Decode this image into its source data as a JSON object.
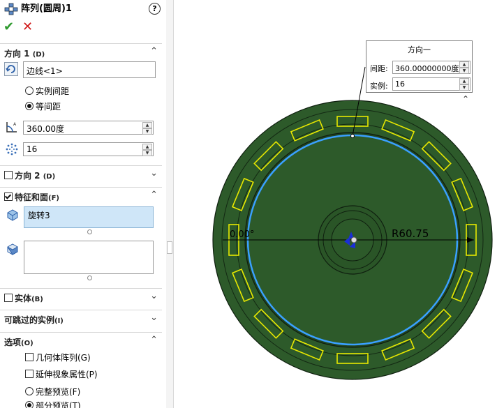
{
  "header": {
    "title": "阵列(圆周)1",
    "help": "?",
    "ok": "✔",
    "cancel": "✕"
  },
  "direction1": {
    "label": "方向 1",
    "key": "(D)",
    "edge": "边线<1>",
    "radio_instance": "实例间距",
    "radio_equal": "等间距",
    "angle": "360.00度",
    "count": "16"
  },
  "direction2": {
    "label": "方向 2",
    "key": "(D)"
  },
  "features": {
    "label": "特征和面",
    "key": "(F)",
    "item": "旋转3"
  },
  "bodies": {
    "label": "实体",
    "key": "(B)"
  },
  "skip": {
    "label": "可跳过的实例",
    "key": "(I)"
  },
  "options": {
    "label": "选项",
    "key": "(O)",
    "geometry_pattern": "几何体阵列(G)",
    "propagate": "延伸视象属性(P)",
    "full_preview": "完整预览(F)",
    "partial_preview": "部分预览(T)"
  },
  "callout": {
    "header": "方向一",
    "spacing_label": "间距:",
    "spacing_value": "360.00000000度",
    "instances_label": "实例:",
    "instances_value": "16"
  },
  "viewport": {
    "dim_left": "0.00°",
    "dim_right": "R60.75"
  },
  "colors": {
    "disk": "#2d5a2a",
    "disk_dark": "#214520",
    "highlight_edge": "#3aa0ff",
    "slots": "#e8e800",
    "selection_bg": "#cfe6f8"
  }
}
